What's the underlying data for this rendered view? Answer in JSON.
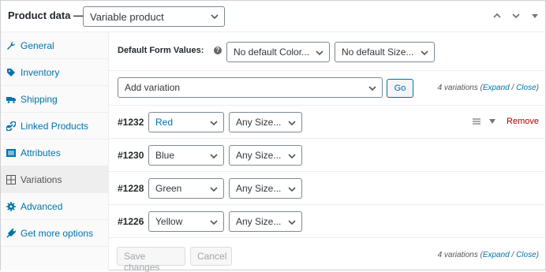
{
  "header": {
    "title": "Product data —",
    "product_type": "Variable product"
  },
  "sidebar": {
    "items": [
      {
        "label": "General",
        "icon": "wrench-icon"
      },
      {
        "label": "Inventory",
        "icon": "tag-icon"
      },
      {
        "label": "Shipping",
        "icon": "truck-icon"
      },
      {
        "label": "Linked Products",
        "icon": "link-icon"
      },
      {
        "label": "Attributes",
        "icon": "list-icon"
      },
      {
        "label": "Variations",
        "icon": "grid-icon"
      },
      {
        "label": "Advanced",
        "icon": "gear-icon"
      },
      {
        "label": "Get more options",
        "icon": "plugin-icon"
      }
    ],
    "active_index": 5
  },
  "defaults": {
    "label": "Default Form Values:",
    "color_value": "No default Color...",
    "size_value": "No default Size..."
  },
  "add_variation": {
    "select_value": "Add variation",
    "go_label": "Go",
    "count_text": "4 variations (",
    "expand_label": "Expand",
    "separator": " / ",
    "close_label": "Close",
    "close_paren": ")"
  },
  "variations": [
    {
      "id": "#1232",
      "color": "Red",
      "size": "Any Size..."
    },
    {
      "id": "#1230",
      "color": "Blue",
      "size": "Any Size..."
    },
    {
      "id": "#1228",
      "color": "Green",
      "size": "Any Size..."
    },
    {
      "id": "#1226",
      "color": "Yellow",
      "size": "Any Size..."
    }
  ],
  "row_tools": {
    "remove_label": "Remove"
  },
  "footer": {
    "save_label": "Save changes",
    "cancel_label": "Cancel",
    "count_text": "4 variations (",
    "expand_label": "Expand",
    "separator": " / ",
    "close_label": "Close",
    "close_paren": ")"
  },
  "colors": {
    "link": "#0073aa",
    "remove": "#aa0000",
    "border": "#7e8993"
  }
}
